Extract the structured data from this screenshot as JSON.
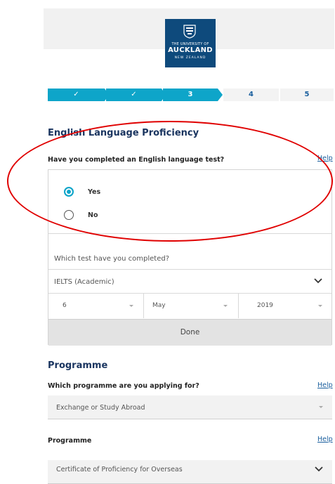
{
  "header": {
    "logo": {
      "line1": "THE UNIVERSITY OF",
      "line2": "AUCKLAND",
      "line3": "NEW ZEALAND"
    }
  },
  "steps": [
    {
      "label": "✓",
      "state": "done"
    },
    {
      "label": "✓",
      "state": "done"
    },
    {
      "label": "3",
      "state": "active"
    },
    {
      "label": "4",
      "state": "todo"
    },
    {
      "label": "5",
      "state": "todo"
    }
  ],
  "english": {
    "title": "English Language Proficiency",
    "question": "Have you completed an English language test?",
    "help": "Help",
    "options": [
      {
        "label": "Yes",
        "selected": true
      },
      {
        "label": "No",
        "selected": false
      }
    ],
    "test_question": "Which test have you completed?",
    "test_value": "IELTS (Academic)",
    "day": "6",
    "month": "May",
    "year": "2019",
    "done": "Done"
  },
  "programme": {
    "title": "Programme",
    "question": "Which programme are you applying for?",
    "help": "Help",
    "value": "Exchange or Study Abroad",
    "label2": "Programme",
    "help2": "Help",
    "value2": "Certificate of Proficiency for Overseas"
  },
  "colors": {
    "accent": "#0ea5c9",
    "navy": "#1a3560",
    "logo_bg": "#0e4a7c",
    "annotation": "#e00000"
  }
}
